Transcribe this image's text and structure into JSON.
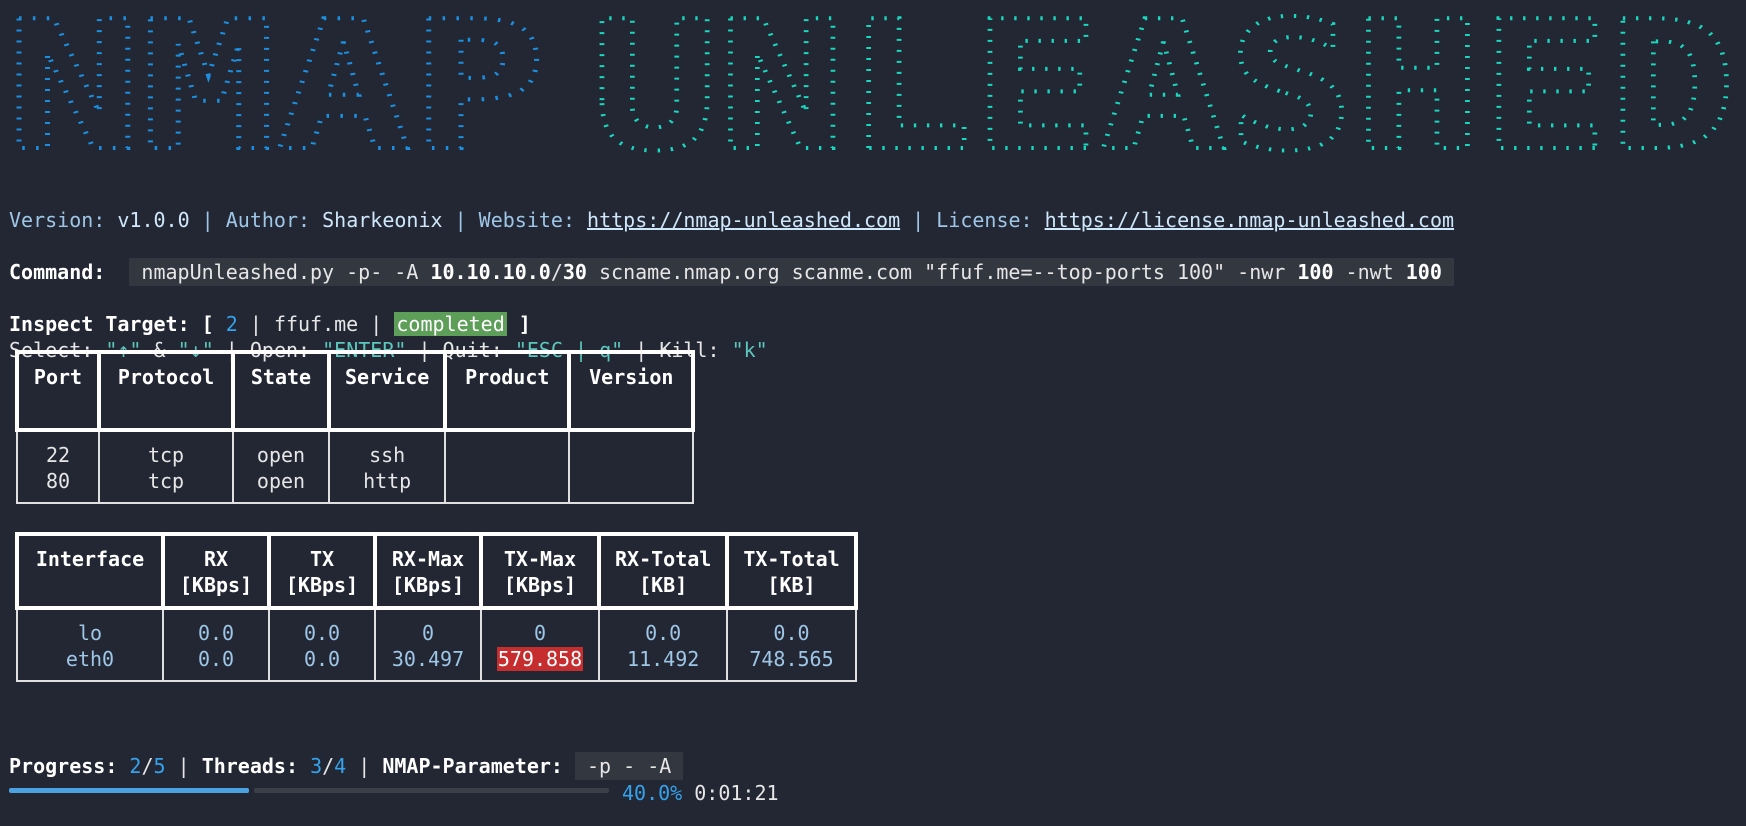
{
  "banner": {
    "word1": "NMAP",
    "word2": "UNLEASHED",
    "color1": "#1b8fe0",
    "color2": "#19d8c0"
  },
  "info": {
    "version_label": "Version:",
    "version_value": "v1.0.0",
    "sep": "|",
    "author_label": "Author:",
    "author_value": "Sharkeonix",
    "website_label": "Website:",
    "website_url": "https://nmap-unleashed.com",
    "license_label": "License:",
    "license_url": "https://license.nmap-unleashed.com"
  },
  "command": {
    "label": "Command:",
    "parts": {
      "p1": "nmapUnleashed.py -p- -A ",
      "p2": "10.10.10.0",
      "p3": "/",
      "p4": "30",
      "p5": " scname.nmap.org scanme.com \"ffuf.me=--top-ports 100\" -nwr ",
      "p6": "100",
      "p7": " -nwt ",
      "p8": "100"
    }
  },
  "inspect": {
    "label": "Inspect Target:",
    "open_bracket": "[",
    "index": "2",
    "target": "ffuf.me",
    "status": "completed",
    "close_bracket": "]"
  },
  "keys": {
    "select_label": "Select:",
    "select_up": "\"↑\"",
    "amp": "&",
    "select_down": "\"↓\"",
    "open_label": "Open:",
    "open_key": "\"ENTER\"",
    "quit_label": "Quit:",
    "quit_key": "\"ESC | q\"",
    "kill_label": "Kill:",
    "kill_key": "\"k\""
  },
  "ports_table": {
    "headers": [
      "Port",
      "Protocol",
      "State",
      "Service",
      "Product",
      "Version"
    ],
    "rows": [
      [
        "22",
        "tcp",
        "open",
        "ssh",
        "",
        ""
      ],
      [
        "80",
        "tcp",
        "open",
        "http",
        "",
        ""
      ]
    ]
  },
  "net_table": {
    "headers": [
      [
        "Interface",
        ""
      ],
      [
        "RX",
        "[KBps]"
      ],
      [
        "TX",
        "[KBps]"
      ],
      [
        "RX-Max",
        "[KBps]"
      ],
      [
        "TX-Max",
        "[KBps]"
      ],
      [
        "RX-Total",
        "[KB]"
      ],
      [
        "TX-Total",
        "[KB]"
      ]
    ],
    "rows": [
      [
        "lo",
        "0.0",
        "0.0",
        "0",
        "0",
        "0.0",
        "0.0"
      ],
      [
        "eth0",
        "0.0",
        "0.0",
        "30.497",
        "579.858",
        "11.492",
        "748.565"
      ]
    ]
  },
  "status": {
    "progress_label": "Progress:",
    "progress_done": "2",
    "progress_total": "5",
    "threads_label": "Threads:",
    "threads_active": "3",
    "threads_total": "4",
    "param_label": "NMAP-Parameter:",
    "param_value": "-p - -A"
  },
  "progress": {
    "fraction": 0.4,
    "percent_text": "40.0%",
    "elapsed": "0:01:21"
  }
}
